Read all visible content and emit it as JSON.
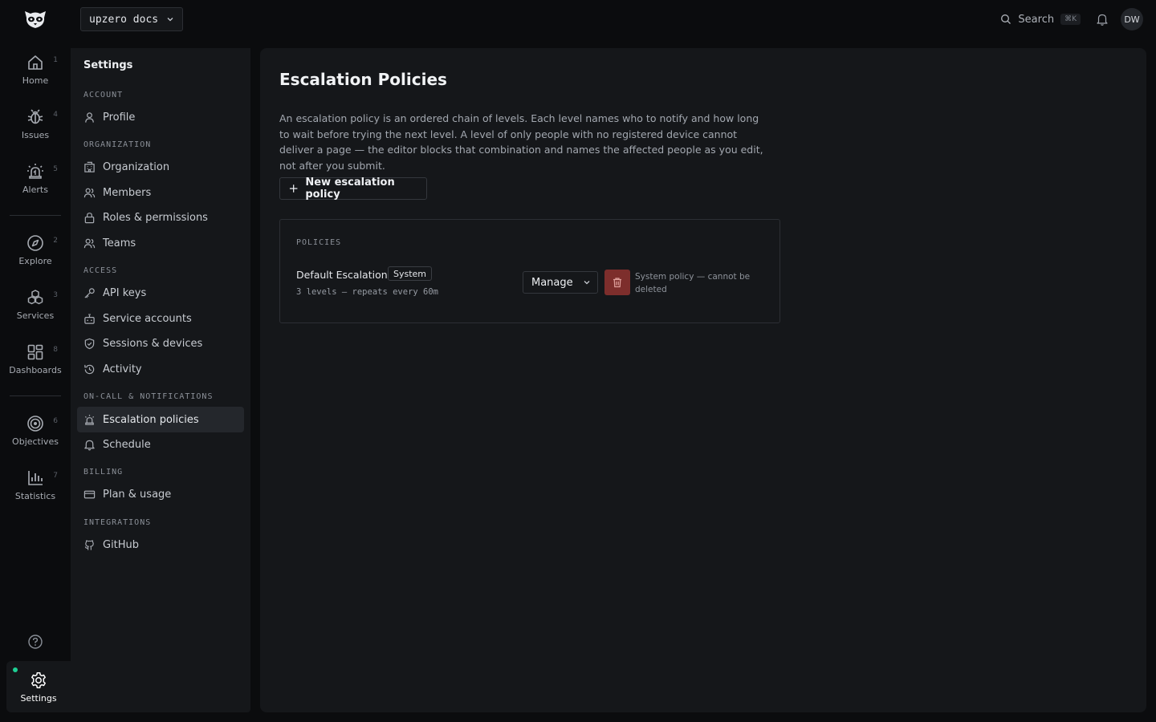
{
  "header": {
    "workspace": "upzero docs",
    "search_label": "Search",
    "search_shortcut": "⌘K",
    "avatar_initials": "DW"
  },
  "rail": {
    "items": [
      {
        "label": "Home",
        "count": "1",
        "icon": "home-icon"
      },
      {
        "label": "Issues",
        "count": "4",
        "icon": "bug-icon"
      },
      {
        "label": "Alerts",
        "count": "5",
        "icon": "alarm-icon"
      },
      {
        "label": "Explore",
        "count": "2",
        "icon": "compass-icon"
      },
      {
        "label": "Services",
        "count": "3",
        "icon": "boxes-icon"
      },
      {
        "label": "Dashboards",
        "count": "8",
        "icon": "grid-icon"
      },
      {
        "label": "Objectives",
        "count": "6",
        "icon": "target-icon"
      },
      {
        "label": "Statistics",
        "count": "7",
        "icon": "bar-chart-icon"
      }
    ],
    "settings_label": "Settings",
    "status_color": "#1ecf94"
  },
  "sidebar": {
    "title": "Settings",
    "sections": {
      "account": "ACCOUNT",
      "organization": "ORGANIZATION",
      "access": "ACCESS",
      "oncall": "ON-CALL & NOTIFICATIONS",
      "billing": "BILLING",
      "integrations": "INTEGRATIONS"
    },
    "items": {
      "profile": "Profile",
      "organization": "Organization",
      "members": "Members",
      "roles": "Roles & permissions",
      "teams": "Teams",
      "api_keys": "API keys",
      "service_accounts": "Service accounts",
      "sessions": "Sessions & devices",
      "activity": "Activity",
      "escalation": "Escalation policies",
      "schedule": "Schedule",
      "plan": "Plan & usage",
      "github": "GitHub"
    },
    "active_item": "Escalation policies"
  },
  "main": {
    "title": "Escalation Policies",
    "description": "An escalation policy is an ordered chain of levels. Each level names who to notify and how long to wait before trying the next level. A level of only people with no registered device cannot deliver a page — the editor blocks that combination and names the affected people as you edit, not after you submit.",
    "new_button": "New escalation policy",
    "policies_label": "POLICIES",
    "policies": [
      {
        "name": "Default Escalation",
        "badge": "System",
        "meta": "3 levels — repeats every 60m",
        "manage_label": "Manage",
        "delete_note": "System policy — cannot be deleted"
      }
    ],
    "danger_color": "#7d2e2c"
  }
}
